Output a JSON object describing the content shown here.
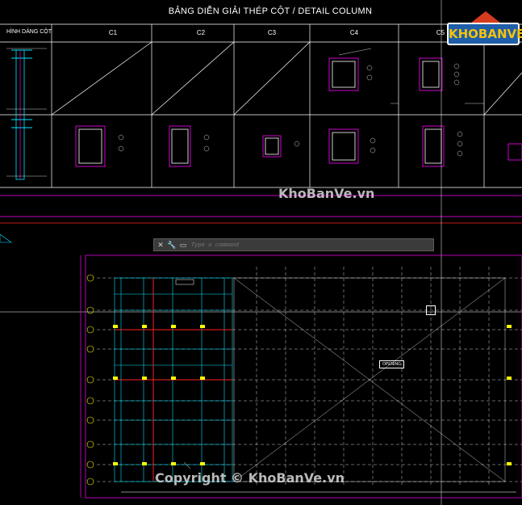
{
  "drawing": {
    "title": "BẢNG DIỄN GIẢI THÉP CỘT / DETAIL COLUMN",
    "row_label": "HÌNH DÁNG CỘT",
    "columns": [
      "C1",
      "C2",
      "C3",
      "C4",
      "C5"
    ],
    "opening_label": "OPENING"
  },
  "command_line": {
    "placeholder": "Type a command",
    "close_icon": "close-icon",
    "settings_icon": "wrench-icon",
    "prompt_icon": "command-prompt-icon"
  },
  "logo": {
    "text": "KHOBANVE"
  },
  "watermarks": {
    "center": "KhoBanVe.vn",
    "bottom": "Copyright © KhoBanVe.vn"
  },
  "colors": {
    "background": "#000000",
    "cyan": "#00e5ff",
    "magenta": "#ff00ff",
    "yellow": "#ffff00",
    "red": "#ff2020",
    "white": "#ffffff",
    "logo_blue": "#1f5ea8",
    "logo_yellow": "#f4c20d"
  }
}
